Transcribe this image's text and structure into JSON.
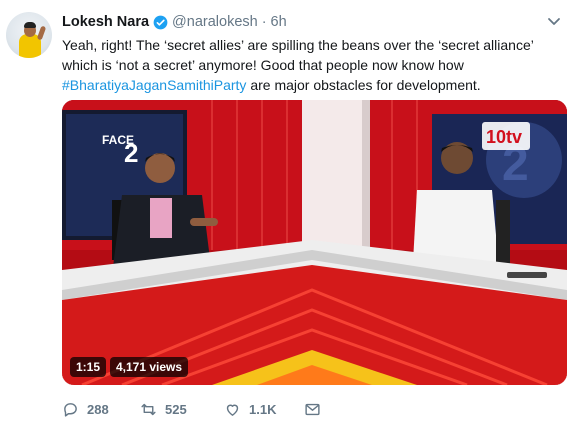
{
  "tweet": {
    "author_name": "Lokesh Nara",
    "handle": "@naralokesh",
    "separator": "·",
    "time": "6h",
    "text_part1": "Yeah, right! The ‘secret allies’ are spilling the beans over the ‘secret alliance’ which is ‘not a secret’ anymore! Good that people now know how ",
    "hashtag": "#BharatiyaJaganSamithiParty",
    "text_part2": " are major obstacles for development."
  },
  "media": {
    "duration": "1:15",
    "views": "4,171 views",
    "channel_logo": "10tv",
    "set_text": "FACE",
    "set_number": "2"
  },
  "actions": {
    "replies": "288",
    "retweets": "525",
    "likes": "1.1K"
  },
  "colors": {
    "accent": "#1b95e0",
    "muted": "#657786",
    "text": "#14171a",
    "studio_red": "#c8101a"
  },
  "icons": {
    "verified": "verified-badge-icon",
    "menu": "chevron-down-icon",
    "reply": "reply-icon",
    "retweet": "retweet-icon",
    "like": "heart-icon",
    "message": "envelope-icon"
  }
}
